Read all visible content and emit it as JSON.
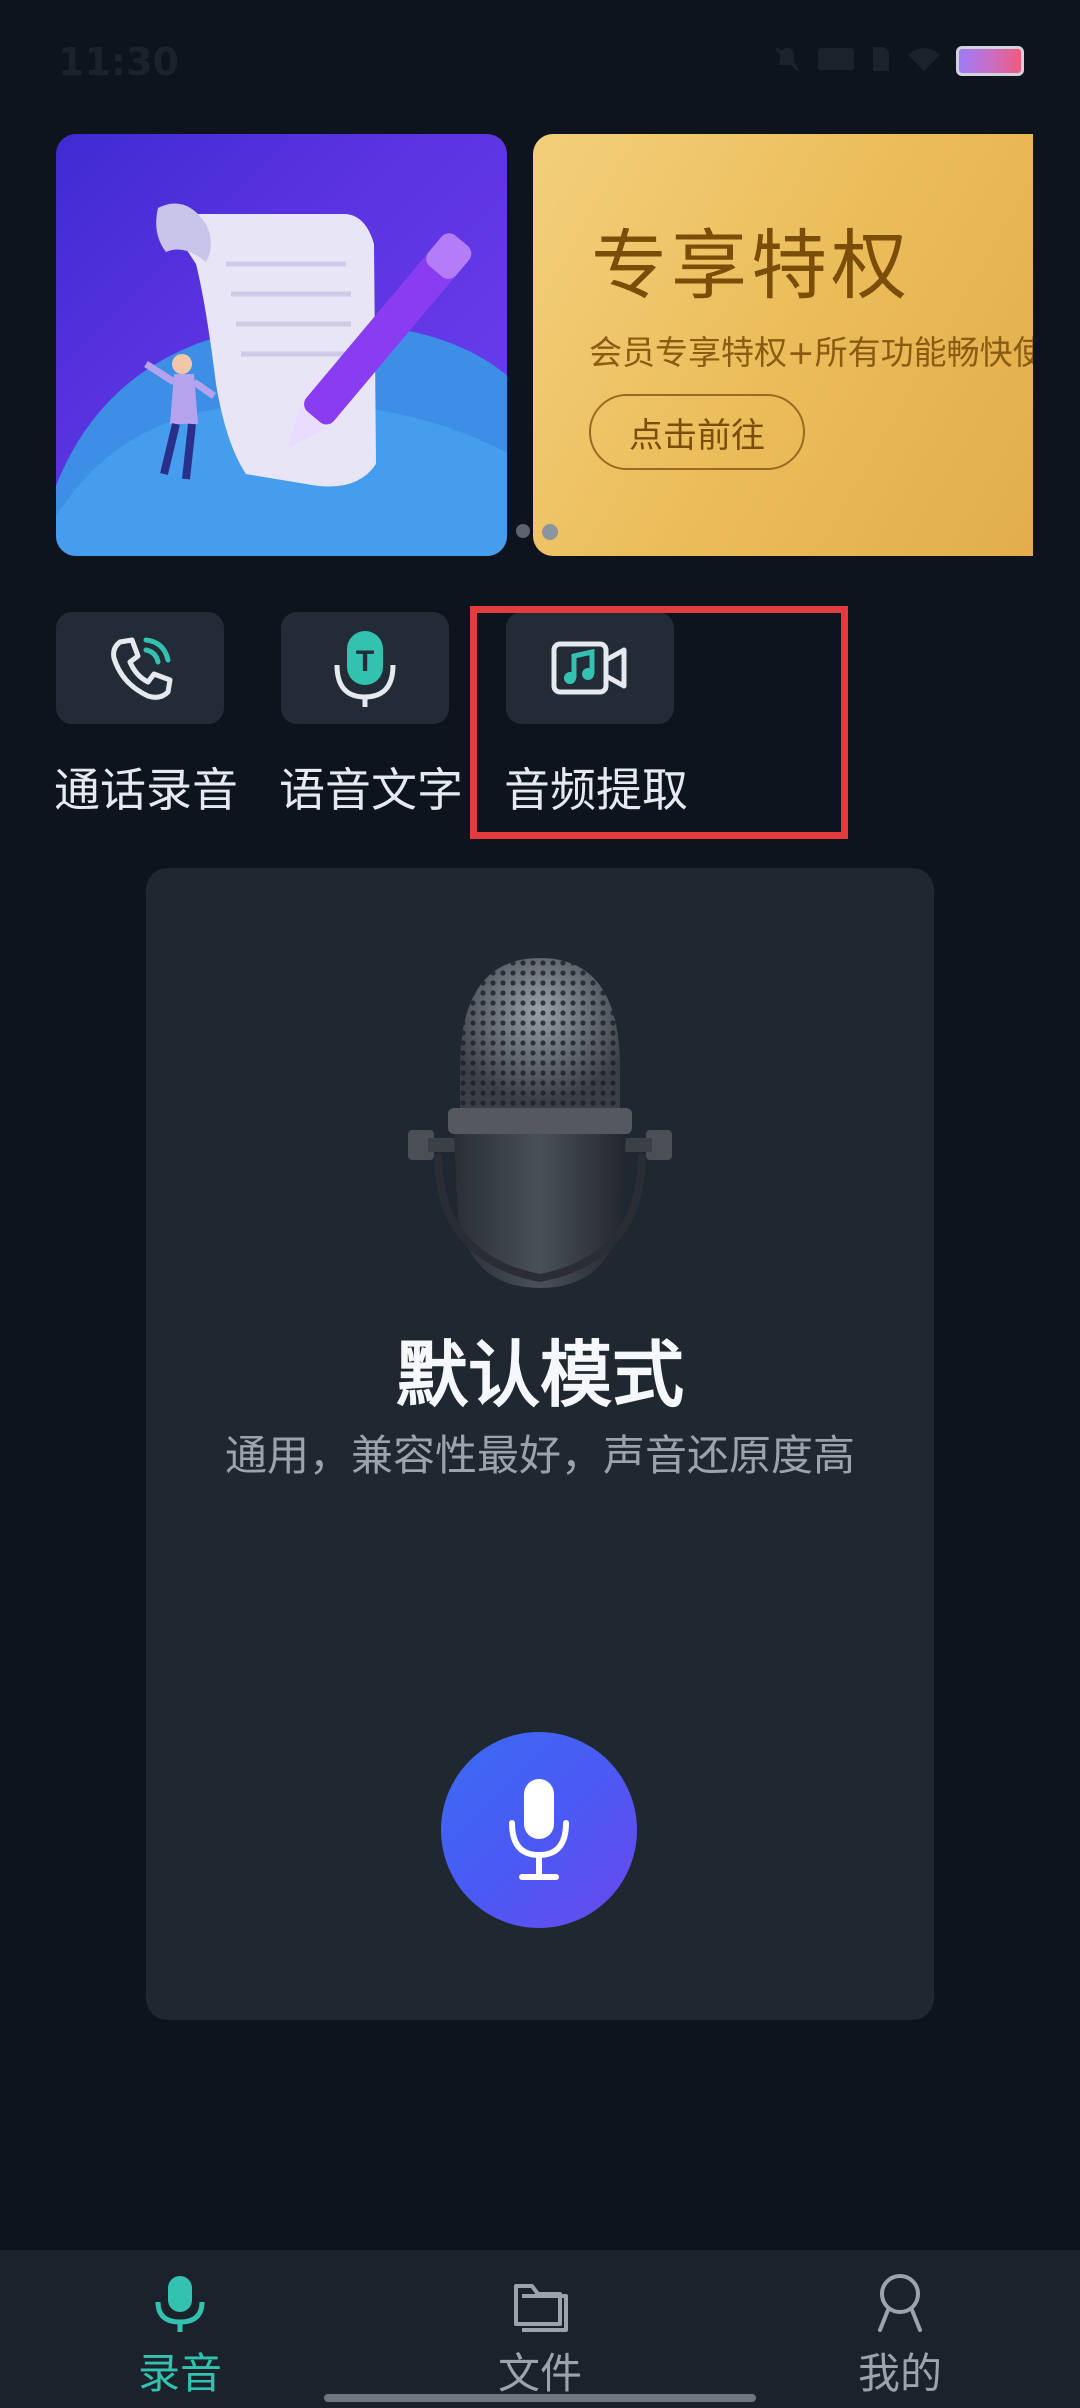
{
  "status_bar": {
    "time": "11:30",
    "icons": [
      "mute-icon",
      "data-speed-icon",
      "sim-icon",
      "wifi-icon",
      "battery-icon"
    ]
  },
  "banners": [
    {
      "name": "writing-illustration"
    },
    {
      "title": "专享特权",
      "subtitle": "会员专享特权+所有功能畅快使",
      "button": "点击前往"
    }
  ],
  "tools": [
    {
      "label": "通话录音",
      "icon": "call-record-icon"
    },
    {
      "label": "语音文字",
      "icon": "speech-to-text-icon"
    },
    {
      "label": "音频提取",
      "icon": "audio-extract-icon"
    }
  ],
  "mode_card": {
    "title": "默认模式",
    "description": "通用，兼容性最好，声音还原度高"
  },
  "tabs": [
    {
      "label": "录音",
      "icon": "microphone-icon",
      "active": true
    },
    {
      "label": "文件",
      "icon": "folder-icon",
      "active": false
    },
    {
      "label": "我的",
      "icon": "profile-icon",
      "active": false
    }
  ],
  "colors": {
    "background": "#0e141e",
    "accent": "#33c2b0",
    "highlight": "#e33c3f",
    "record_button": "#4a5af4"
  }
}
